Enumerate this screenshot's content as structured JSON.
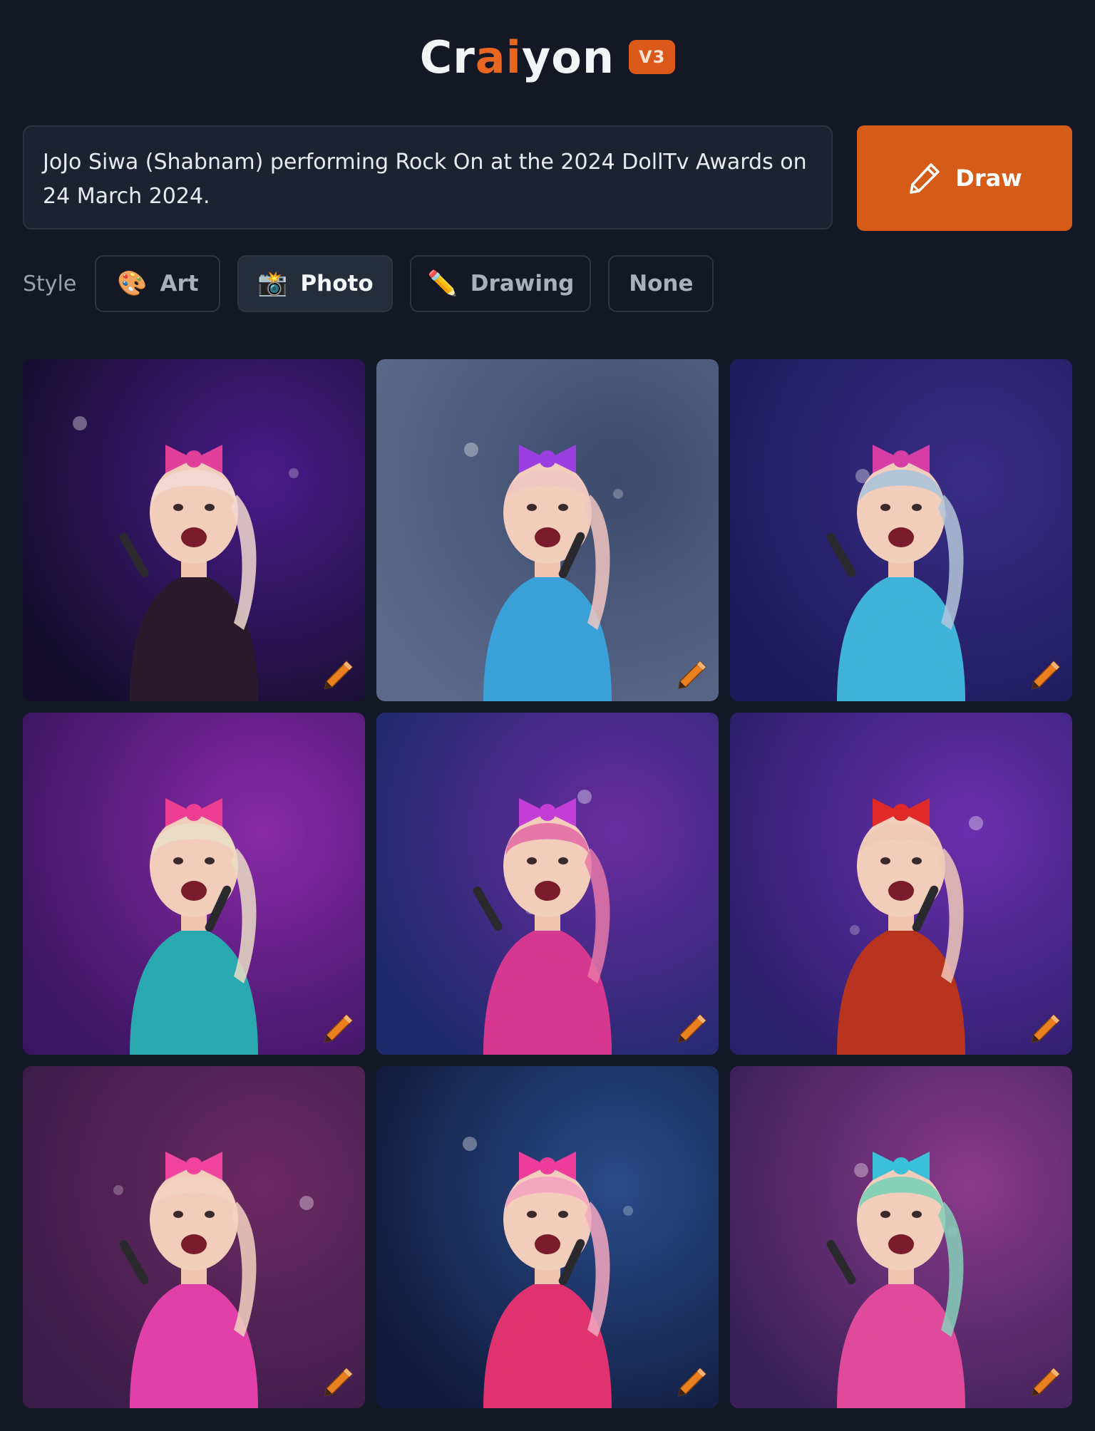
{
  "header": {
    "logo_part1": "Cr",
    "logo_part2": "ai",
    "logo_part3": "yon",
    "version": "V3"
  },
  "prompt": {
    "text": "JoJo Siwa (Shabnam) performing Rock On at the 2024 DollTv Awards on 24 March 2024."
  },
  "draw_button": {
    "label": "Draw",
    "icon": "pencil-icon"
  },
  "style": {
    "label": "Style",
    "options": [
      {
        "label": "Art",
        "emoji": "🎨",
        "icon": "palette-icon",
        "active": false
      },
      {
        "label": "Photo",
        "emoji": "📸",
        "icon": "camera-flash-icon",
        "active": true
      },
      {
        "label": "Drawing",
        "emoji": "✏️",
        "icon": "pencil-icon",
        "active": false
      },
      {
        "label": "None",
        "emoji": "",
        "icon": "",
        "active": false
      }
    ]
  },
  "results": {
    "count": 9,
    "overlay_icon": "pencil-edit-icon",
    "tiles": [
      {
        "alt": "performer in black sequin jacket with pink bow, purple stage light",
        "bg1": "#140e2c",
        "bg2": "#4a1b8a",
        "bow": "#e0409a",
        "outfit": "#2a1a2c",
        "hair": "#f1d8d0"
      },
      {
        "alt": "performer with purple bow singing into microphone, blue sequin outfit",
        "bg1": "#5b6a8a",
        "bg2": "#3c4a6c",
        "bow": "#9b3ee0",
        "outfit": "#3aa0d8",
        "hair": "#f0c6c2"
      },
      {
        "alt": "close-up performer with pink and blue bows, turquoise sparkly jacket",
        "bg1": "#1c1a5c",
        "bg2": "#3b2d86",
        "bow": "#d63ea6",
        "outfit": "#3fb3d9",
        "hair": "#b3c6d8"
      },
      {
        "alt": "performer with long blonde ponytail, teal sequin jacket, pink bow",
        "bg1": "#3a1562",
        "bg2": "#8a2aa8",
        "bow": "#ee3e94",
        "outfit": "#2aa8b0",
        "hair": "#eadcc6"
      },
      {
        "alt": "performer with purple bow singing, pink striped sequin outfit",
        "bg1": "#1d2a6c",
        "bg2": "#6a2ca0",
        "bow": "#c23ed6",
        "outfit": "#d6388f",
        "hair": "#e678a8"
      },
      {
        "alt": "performer with red bow and red jacket, colorful sequin top",
        "bg1": "#2a1f6a",
        "bg2": "#6b2fae",
        "bow": "#e02a2a",
        "outfit": "#b8341f",
        "hair": "#f0c8b8"
      },
      {
        "alt": "performer in pink sequin dress with pink bow, bokeh stage lights",
        "bg1": "#3a1c48",
        "bg2": "#6c2a62",
        "bow": "#f0449c",
        "outfit": "#e040a8",
        "hair": "#f2d2c0"
      },
      {
        "alt": "performer with large pink bow and pink hair, singing into microphone",
        "bg1": "#101a3c",
        "bg2": "#2a4c8a",
        "bow": "#ee3c9a",
        "outfit": "#e0326e",
        "hair": "#f3a8c0"
      },
      {
        "alt": "performer with blue and pink bows, sparkly outfit, waving",
        "bg1": "#3a2058",
        "bg2": "#8a3a8a",
        "bow": "#3ac0d8",
        "outfit": "#e04a9a",
        "hair": "#86d0b8"
      }
    ]
  }
}
